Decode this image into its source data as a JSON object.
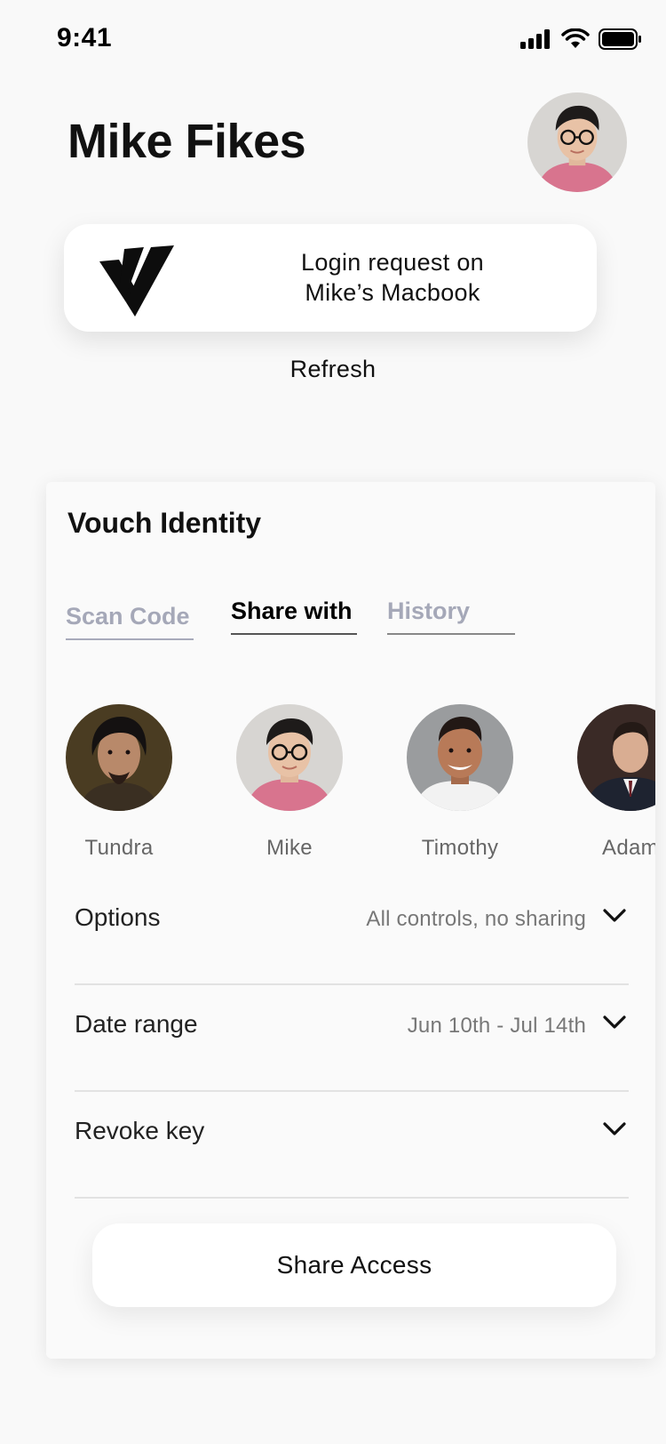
{
  "status_bar": {
    "time": "9:41"
  },
  "user": {
    "name": "Mike Fikes"
  },
  "login_card": {
    "line1": "Login request on",
    "line2": "Mike’s Macbook"
  },
  "refresh_label": "Refresh",
  "panel": {
    "title": "Vouch Identity",
    "tabs": [
      {
        "label": "Scan Code",
        "active": false
      },
      {
        "label": "Share with",
        "active": true
      },
      {
        "label": "History",
        "active": false
      }
    ],
    "contacts": [
      {
        "name": "Tundra"
      },
      {
        "name": "Mike"
      },
      {
        "name": "Timothy"
      },
      {
        "name": "Adam"
      }
    ],
    "options": {
      "label": "Options",
      "value": "All controls, no sharing"
    },
    "date_range": {
      "label": "Date range",
      "value": "Jun 10th - Jul 14th"
    },
    "revoke": {
      "label": "Revoke key"
    },
    "share_button": "Share Access"
  },
  "colors": {
    "background": "#f9f9f9",
    "card": "#ffffff",
    "inactive_tab": "#a5a8b8",
    "secondary_text": "#777777"
  }
}
